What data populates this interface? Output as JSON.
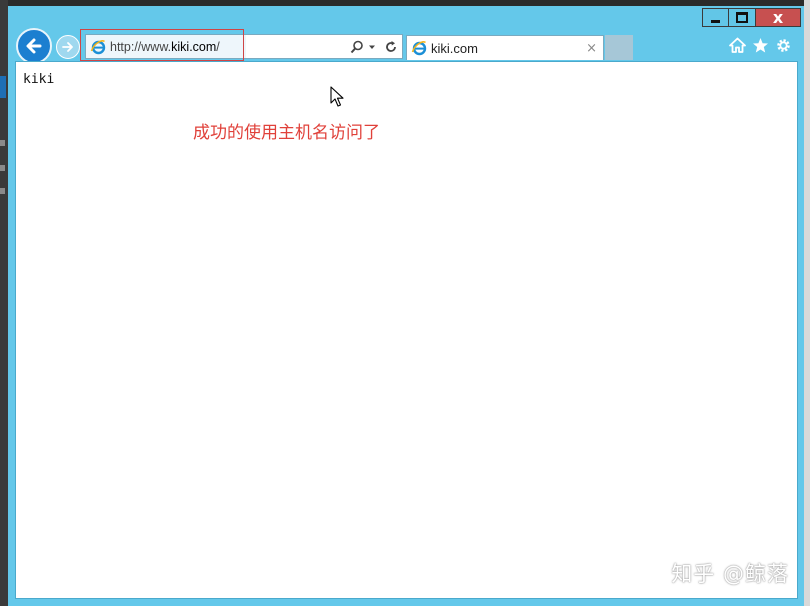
{
  "window": {
    "caption": {
      "minimize": "",
      "maximize": "",
      "close": "x"
    }
  },
  "nav": {
    "back_icon": "back-arrow-icon",
    "forward_icon": "forward-arrow-icon"
  },
  "address_bar": {
    "url_prefix": "http://www.",
    "url_host": "kiki.com",
    "url_suffix": "/",
    "search_icon": "search-icon",
    "dropdown_icon": "chevron-down-icon",
    "refresh_icon": "refresh-icon"
  },
  "tab": {
    "title": "kiki.com",
    "close": "×"
  },
  "toolbar": {
    "home_icon": "home-icon",
    "favorites_icon": "star-icon",
    "settings_icon": "gear-icon"
  },
  "page": {
    "body_text": "kiki"
  },
  "annotation": {
    "text": "成功的使用主机名访问了",
    "color": "#e0413a"
  },
  "watermark": {
    "text": "知乎 @鲸落"
  },
  "colors": {
    "frame": "#64c8ea",
    "close_button": "#c75050",
    "accent": "#1c7fd0"
  }
}
